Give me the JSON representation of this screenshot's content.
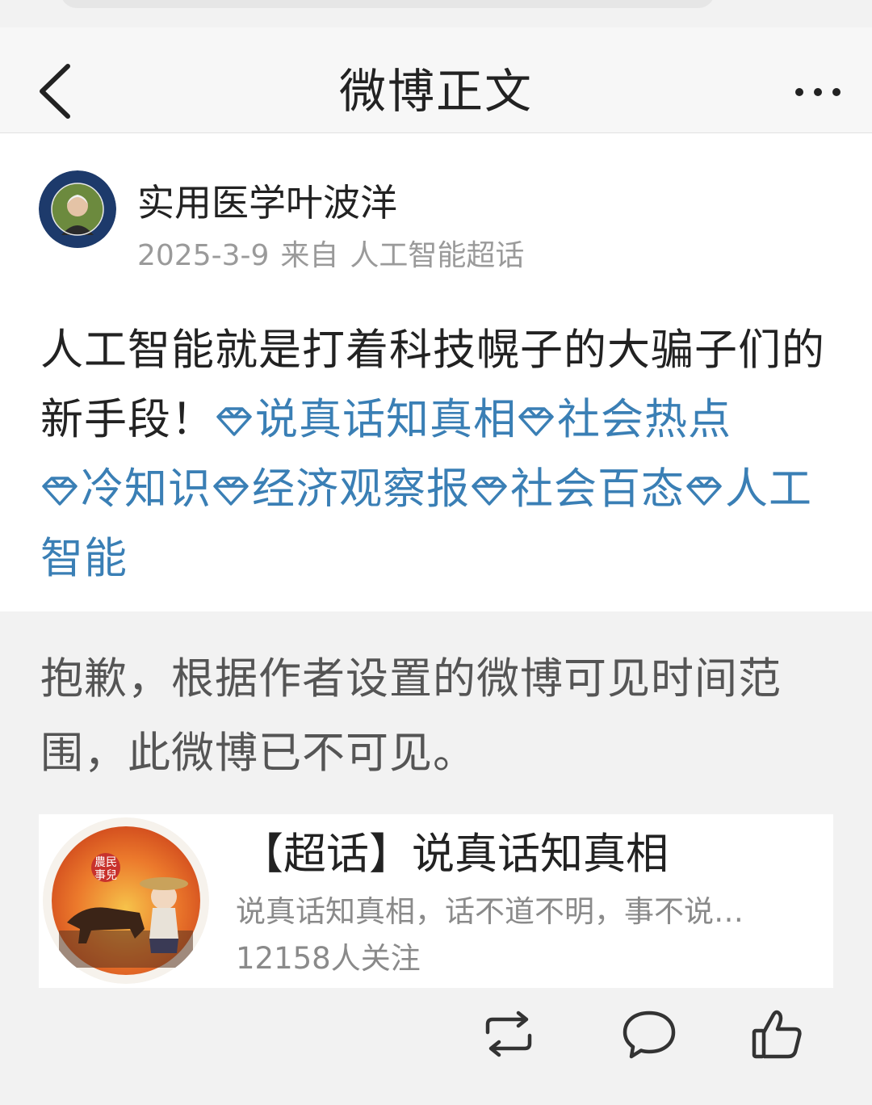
{
  "nav": {
    "title": "微博正文"
  },
  "post": {
    "author": "实用医学叶波洋",
    "date": "2025-3-9",
    "from_label": "来自",
    "source": "人工智能超话",
    "text": "人工智能就是打着科技幌子的大骗子们的新手段！",
    "topics": [
      "说真话知真相",
      "社会热点",
      "冷知识",
      "经济观察报",
      "社会百态",
      "人工智能"
    ]
  },
  "notice": "抱歉，根据作者设置的微博可见时间范围，此微博已不可见。",
  "supertopic": {
    "title": "【超话】说真话知真相",
    "description": "说真话知真相，话不道不明，事不说…",
    "followers": "12158人关注",
    "image_text": "農民事兒"
  },
  "colors": {
    "topic": "#3a7fb5",
    "meta": "#9a9a9a",
    "nav_bg": "#f7f7f7",
    "page_bg": "#f2f2f2"
  },
  "icons": {
    "back": "chevron-left-icon",
    "more": "more-dots-icon",
    "topic": "diamond-icon",
    "repost": "repost-icon",
    "comment": "comment-icon",
    "like": "thumbs-up-icon"
  }
}
